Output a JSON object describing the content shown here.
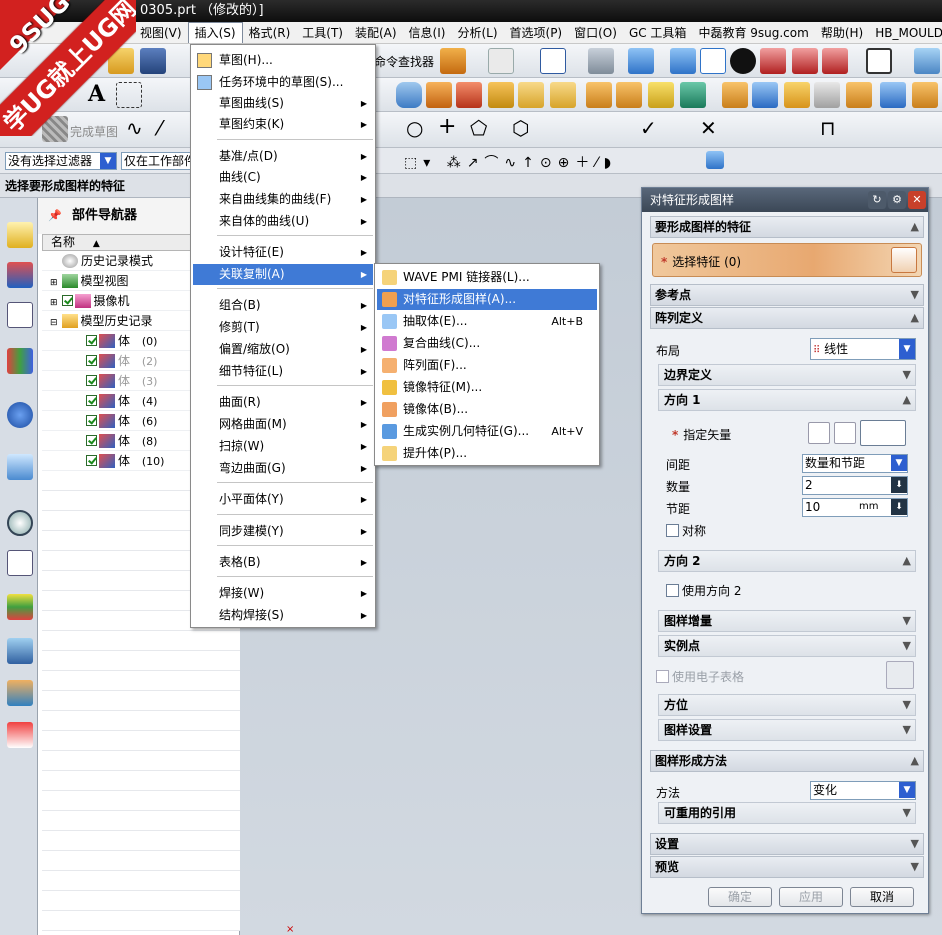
{
  "window": {
    "title": "0305.prt （修改的）]"
  },
  "logo": {
    "top": "9SUG",
    "bottom": "学UG就上UG网"
  },
  "menubar": {
    "items": [
      "视图(V)",
      "插入(S)",
      "格式(R)",
      "工具(T)",
      "装配(A)",
      "信息(I)",
      "分析(L)",
      "首选项(P)",
      "窗口(O)",
      "GC 工具箱",
      "中磊教育 9sug.com",
      "帮助(H)",
      "HB_MOULD M"
    ],
    "active_index": 1
  },
  "toolbar": {
    "cmd_finder_label": "命令查找器",
    "finish_sketch_label": "完成草图"
  },
  "filterbar": {
    "selection_filter": "没有选择过滤器",
    "scope": "仅在工作部件"
  },
  "status": {
    "prompt": "选择要形成图样的特征"
  },
  "navigator": {
    "title": "部件导航器",
    "column_name": "名称",
    "rows": [
      {
        "label": "历史记录模式",
        "grey": false
      },
      {
        "label": "模型视图",
        "grey": false
      },
      {
        "label": "摄像机",
        "grey": false
      },
      {
        "label": "模型历史记录",
        "grey": false
      },
      {
        "label": "体",
        "num": "(0)",
        "grey": false
      },
      {
        "label": "体",
        "num": "(2)",
        "grey": true
      },
      {
        "label": "体",
        "num": "(3)",
        "grey": true
      },
      {
        "label": "体",
        "num": "(4)",
        "grey": false
      },
      {
        "label": "体",
        "num": "(6)",
        "grey": false
      },
      {
        "label": "体",
        "num": "(8)",
        "grey": false
      },
      {
        "label": "体",
        "num": "(10)",
        "grey": false
      }
    ]
  },
  "insert_menu": {
    "items": [
      {
        "label": "草图(H)...",
        "has_sub": false
      },
      {
        "label": "任务环境中的草图(S)...",
        "has_sub": false
      },
      {
        "label": "草图曲线(S)",
        "has_sub": true
      },
      {
        "label": "草图约束(K)",
        "has_sub": true
      },
      {
        "label": "基准/点(D)",
        "has_sub": true
      },
      {
        "label": "曲线(C)",
        "has_sub": true
      },
      {
        "label": "来自曲线集的曲线(F)",
        "has_sub": true
      },
      {
        "label": "来自体的曲线(U)",
        "has_sub": true
      },
      {
        "label": "设计特征(E)",
        "has_sub": true
      },
      {
        "label": "关联复制(A)",
        "has_sub": true
      },
      {
        "label": "组合(B)",
        "has_sub": true
      },
      {
        "label": "修剪(T)",
        "has_sub": true
      },
      {
        "label": "偏置/缩放(O)",
        "has_sub": true
      },
      {
        "label": "细节特征(L)",
        "has_sub": true
      },
      {
        "label": "曲面(R)",
        "has_sub": true
      },
      {
        "label": "网格曲面(M)",
        "has_sub": true
      },
      {
        "label": "扫掠(W)",
        "has_sub": true
      },
      {
        "label": "弯边曲面(G)",
        "has_sub": true
      },
      {
        "label": "小平面体(Y)",
        "has_sub": true
      },
      {
        "label": "同步建模(Y)",
        "has_sub": true
      },
      {
        "label": "表格(B)",
        "has_sub": true
      },
      {
        "label": "焊接(W)",
        "has_sub": true
      },
      {
        "label": "结构焊接(S)",
        "has_sub": true
      }
    ],
    "highlighted_index": 9
  },
  "assoc_copy_menu": {
    "items": [
      {
        "label": "WAVE PMI 链接器(L)...",
        "shortcut": ""
      },
      {
        "label": "对特征形成图样(A)...",
        "shortcut": ""
      },
      {
        "label": "抽取体(E)...",
        "shortcut": "Alt+B"
      },
      {
        "label": "复合曲线(C)...",
        "shortcut": ""
      },
      {
        "label": "阵列面(F)...",
        "shortcut": ""
      },
      {
        "label": "镜像特征(M)...",
        "shortcut": ""
      },
      {
        "label": "镜像体(B)...",
        "shortcut": ""
      },
      {
        "label": "生成实例几何特征(G)...",
        "shortcut": "Alt+V"
      },
      {
        "label": "提升体(P)...",
        "shortcut": ""
      }
    ],
    "highlighted_index": 1
  },
  "dialog": {
    "title": "对特征形成图样",
    "sec_feature": "要形成图样的特征",
    "select_feature": "选择特征 (0)",
    "sec_ref": "参考点",
    "sec_array": "阵列定义",
    "layout_label": "布局",
    "layout_value": "线性",
    "boundary": "边界定义",
    "dir1": "方向 1",
    "vector_label": "指定矢量",
    "spacing_label": "间距",
    "spacing_value": "数量和节距",
    "count_label": "数量",
    "count_value": "2",
    "pitch_label": "节距",
    "pitch_value": "10",
    "pitch_unit": "mm",
    "symmetric": "对称",
    "dir2": "方向 2",
    "use_dir2": "使用方向 2",
    "increment": "图样增量",
    "instance_point": "实例点",
    "use_spreadsheet": "使用电子表格",
    "orientation": "方位",
    "pattern_settings": "图样设置",
    "sec_method": "图样形成方法",
    "method_label": "方法",
    "method_value": "变化",
    "reusable": "可重用的引用",
    "sec_settings": "设置",
    "sec_preview": "预览",
    "ok": "确定",
    "apply": "应用",
    "cancel": "取消"
  }
}
